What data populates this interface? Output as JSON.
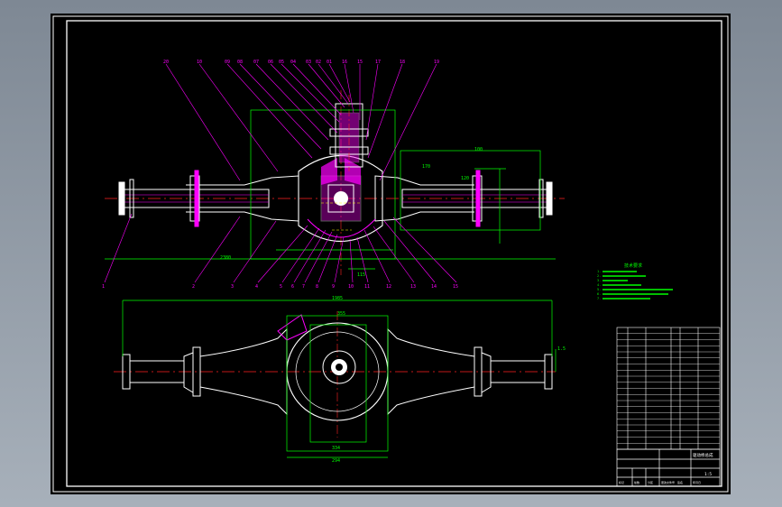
{
  "drawing": {
    "balloon_numbers_top": [
      "20",
      "10",
      "09",
      "08",
      "07",
      "06",
      "05",
      "04",
      "03",
      "02",
      "01",
      "16",
      "15",
      "17",
      "18",
      "19"
    ],
    "balloon_numbers_bottom": [
      "1",
      "2",
      "3",
      "4",
      "5",
      "6",
      "7",
      "8",
      "9",
      "10",
      "11",
      "12",
      "13",
      "14",
      "15"
    ],
    "section_dims": [
      "2380",
      "170",
      "120",
      "115",
      "100"
    ],
    "plan_dims": [
      "1985",
      "355",
      "334",
      "294",
      "1.5"
    ],
    "tech_notes_title": "技术要求",
    "tech_notes_lines": [
      "1.",
      "2.",
      "3.",
      "4.",
      "5.",
      "6.",
      "7."
    ],
    "title_block": {
      "drawing_title": "驱动桥总成",
      "scale": "1:5",
      "row_labels": [
        "标记",
        "处数",
        "分区",
        "更改文件号",
        "签名",
        "年月日"
      ]
    }
  },
  "colors": {
    "background": "#000000",
    "outline": "#ffffff",
    "dimension": "#00ff00",
    "leader": "#ff00ff",
    "centerline": "#ff2020",
    "section_fill": "#ff00ff",
    "hidden": "#ffff00"
  }
}
